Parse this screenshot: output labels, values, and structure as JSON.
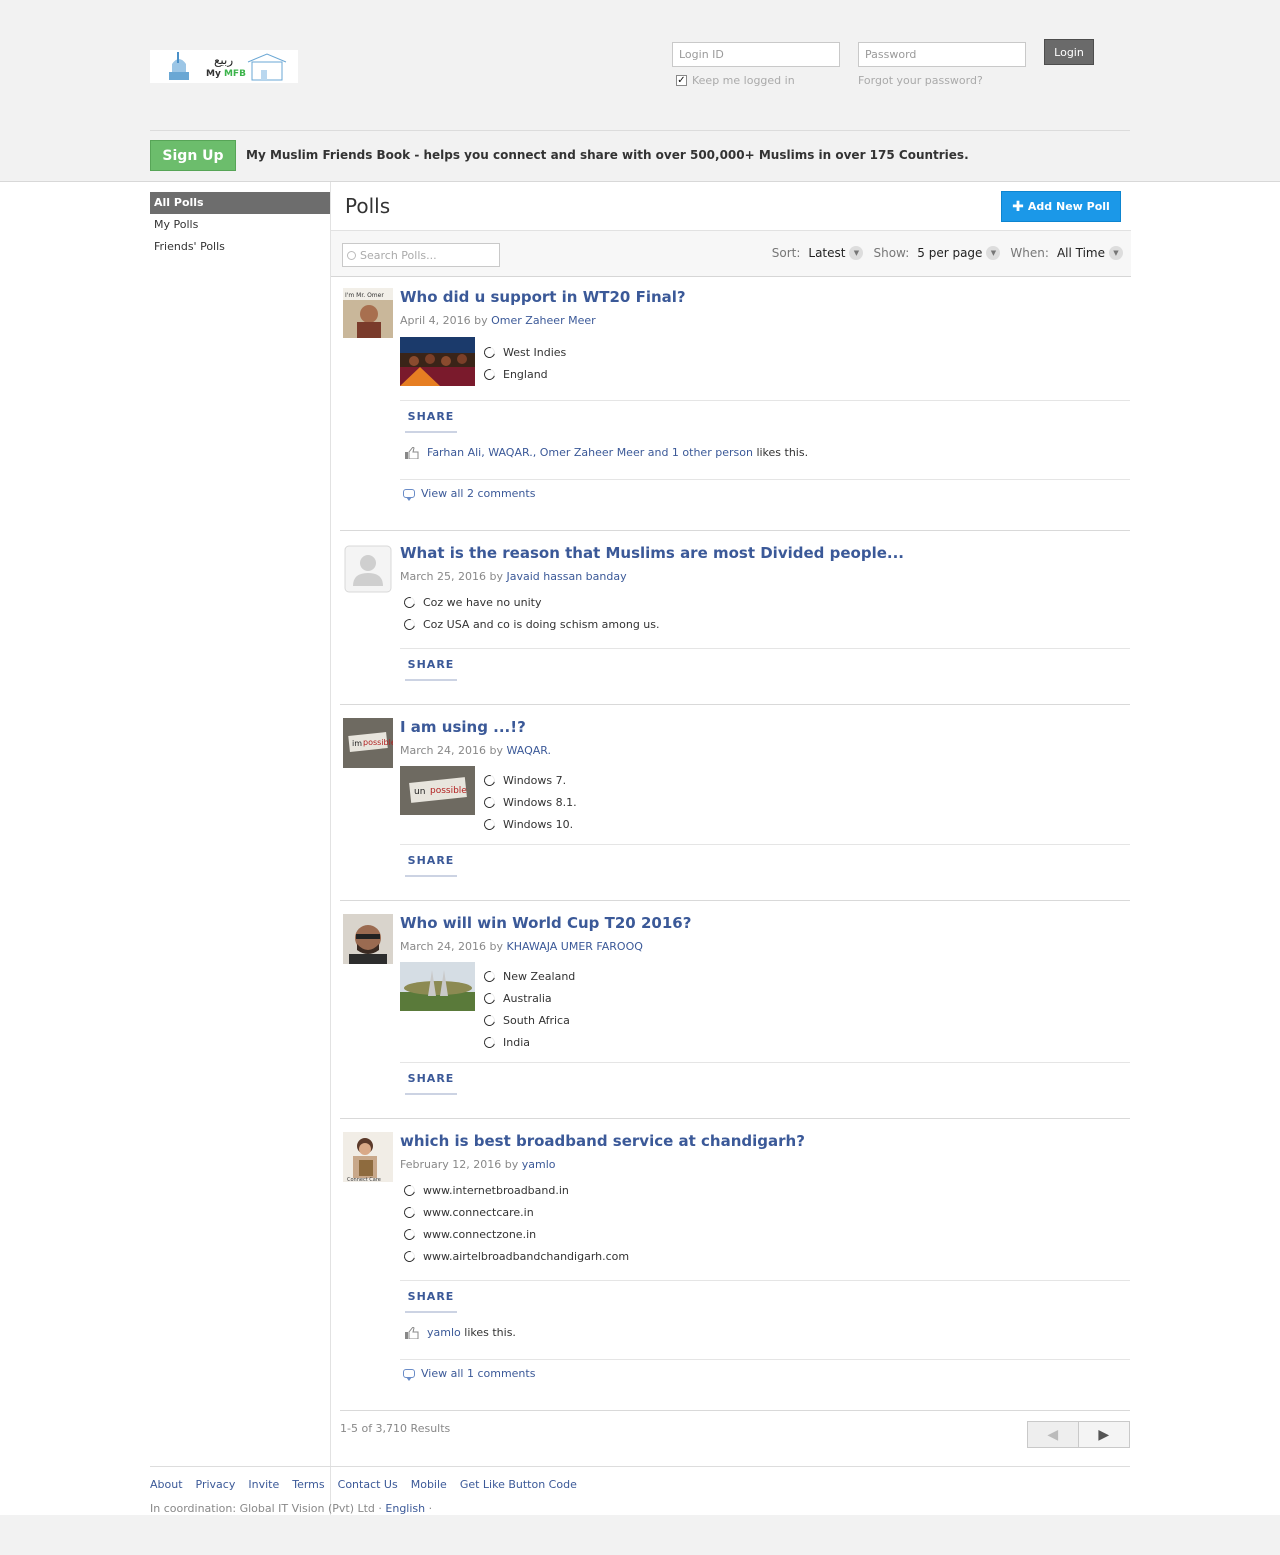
{
  "header": {
    "logo_text_my": "My",
    "logo_text_mfb": "MFB",
    "login_id_placeholder": "Login ID",
    "password_placeholder": "Password",
    "login_label": "Login",
    "keep_logged_in": "Keep me logged in",
    "forgot_password": "Forgot your password?",
    "signup_label": "Sign Up",
    "tagline": "My Muslim Friends Book - helps you connect and share with over 500,000+ Muslims in over 175 Countries."
  },
  "sidebar": {
    "items": [
      {
        "label": "All Polls",
        "active": true
      },
      {
        "label": "My Polls",
        "active": false
      },
      {
        "label": "Friends' Polls",
        "active": false
      }
    ]
  },
  "page": {
    "title": "Polls",
    "add_poll_label": "Add New Poll",
    "search_placeholder": "Search Polls...",
    "sort_label": "Sort:",
    "sort_value": "Latest",
    "show_label": "Show:",
    "show_value": "5 per page",
    "when_label": "When:",
    "when_value": "All Time"
  },
  "polls": [
    {
      "title": "Who did u support in WT20 Final?",
      "date": "April 4, 2016",
      "by": "by",
      "author": "Omer Zaheer Meer",
      "options": [
        "West Indies",
        "England"
      ],
      "share": "SHARE",
      "likers": "Farhan Ali, WAQAR., Omer Zaheer Meer and 1 other person",
      "likes_suffix": "likes this.",
      "comments": "View all 2 comments"
    },
    {
      "title": "What is the reason that Muslims are most Divided people...",
      "date": "March 25, 2016",
      "by": "by",
      "author": "Javaid hassan banday",
      "options": [
        "Coz we have no unity",
        "Coz USA and co is doing schism among us."
      ],
      "share": "SHARE"
    },
    {
      "title": "I am using ...!?",
      "date": "March 24, 2016",
      "by": "by",
      "author": "WAQAR.",
      "options": [
        "Windows 7.",
        "Windows 8.1.",
        "Windows 10."
      ],
      "share": "SHARE"
    },
    {
      "title": "Who will win World Cup T20 2016?",
      "date": "March 24, 2016",
      "by": "by",
      "author": "KHAWAJA UMER FAROOQ",
      "options": [
        "New Zealand",
        "Australia",
        "South Africa",
        "India"
      ],
      "share": "SHARE"
    },
    {
      "title": "which is best broadband service at chandigarh?",
      "date": "February 12, 2016",
      "by": "by",
      "author": "yamlo",
      "options": [
        "www.internetbroadband.in",
        "www.connectcare.in",
        "www.connectzone.in",
        "www.airtelbroadbandchandigarh.com"
      ],
      "share": "SHARE",
      "likers": "yamlo",
      "likes_suffix": "likes this.",
      "comments": "View all 1 comments"
    }
  ],
  "pagination": {
    "results": "1-5 of 3,710 Results",
    "prev": "◀",
    "next": "▶"
  },
  "footer": {
    "links": [
      "About",
      "Privacy",
      "Invite",
      "Terms",
      "Contact Us",
      "Mobile",
      "Get Like Button Code"
    ],
    "credit": "In coordination: Global IT Vision (Pvt) Ltd ·",
    "language": "English",
    "credit_end": "·"
  }
}
